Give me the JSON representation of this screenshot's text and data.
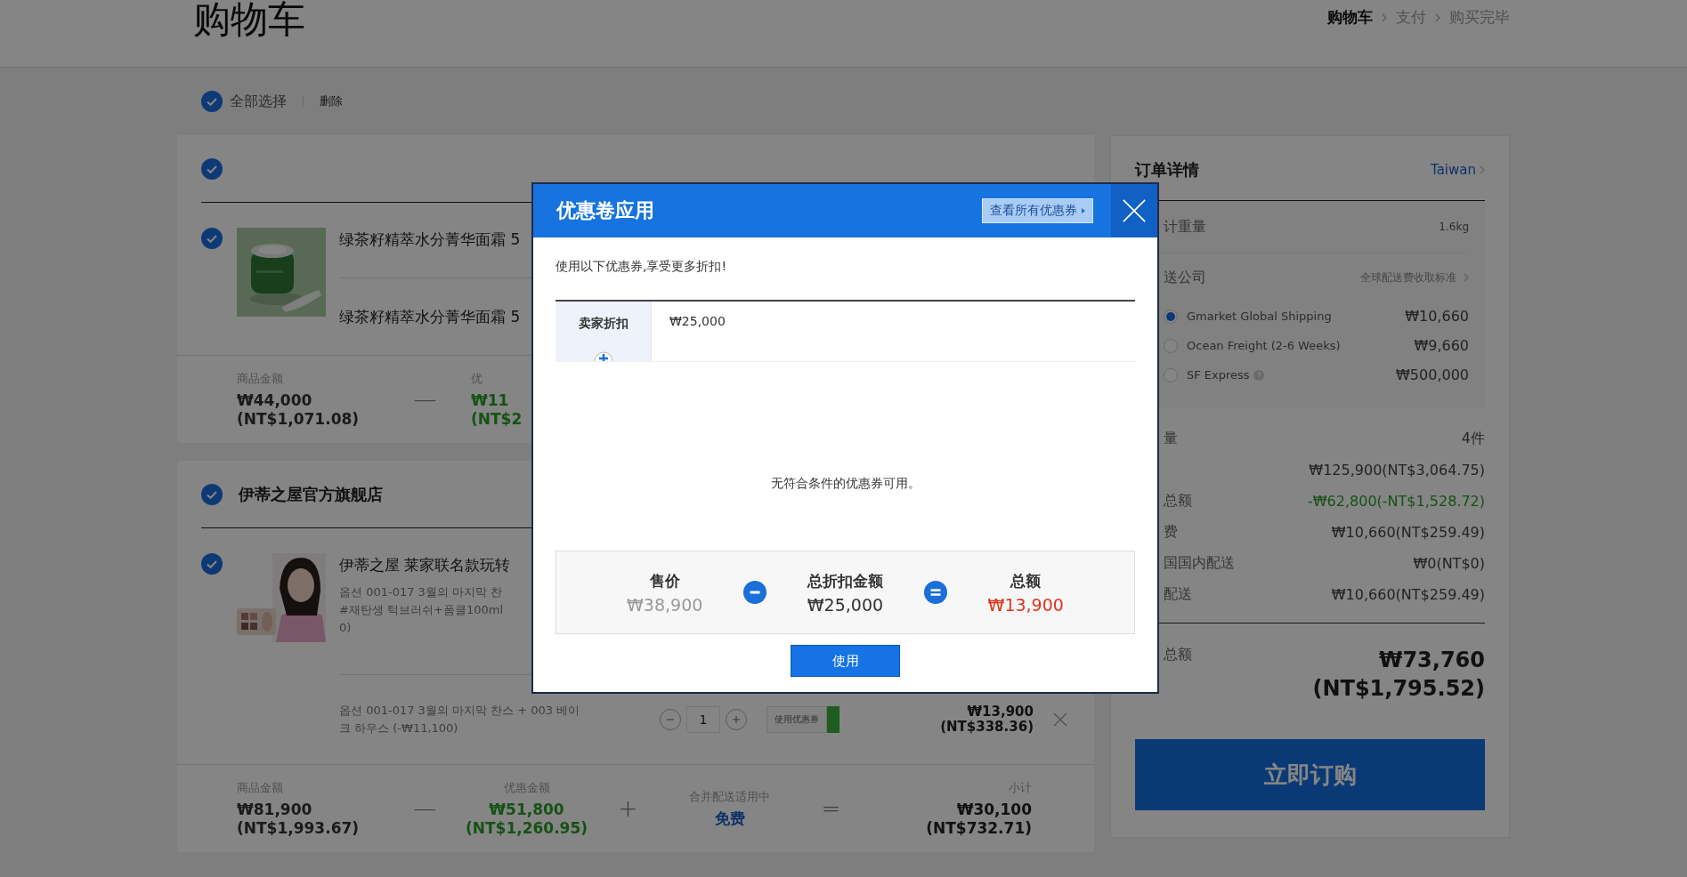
{
  "header": {
    "title": "购物车",
    "steps": [
      {
        "label": "购物车",
        "selected": true
      },
      {
        "label": "支付",
        "selected": false
      },
      {
        "label": "购买完毕",
        "selected": false
      }
    ]
  },
  "toolbar": {
    "select_all": {
      "label": "全部选择",
      "checked": true
    },
    "delete": "删除"
  },
  "sellers": [
    {
      "checked": true,
      "items": [
        {
          "checked": true,
          "title": "绿茶籽精萃水分菁华面霜 5",
          "option_rows": [
            {
              "lines": [
                "绿茶籽精萃水分菁华面霜 5"
              ]
            }
          ]
        }
      ],
      "summary": [
        {
          "kind": "amount",
          "label": "商品金额",
          "value": "₩44,000",
          "sub": "(NT$1,071.08)"
        },
        {
          "kind": "operator",
          "symbol": "—"
        },
        {
          "kind": "discount",
          "label": "优",
          "value": "₩11",
          "sub": "(NT$2"
        }
      ]
    },
    {
      "name": "伊蒂之屋官方旗舰店",
      "checked": true,
      "items": [
        {
          "checked": true,
          "title": "伊蒂之屋 莱家联名款玩转",
          "details": [
            "옵션 001-017 3월의 마지막 찬",
            "#재탄생 턱브러쉬+폼클100ml",
            "0)"
          ],
          "option_rows": [
            {
              "lines": [
                "옵션 001-017 3월의 마지막 찬스 + 003 베이",
                "크 하우스 (-₩11,100)"
              ],
              "quantity": "1",
              "coupon_button": "使用优惠券",
              "price": "₩13,900",
              "price_nt": "(NT$338.36)"
            }
          ]
        }
      ],
      "summary": [
        {
          "kind": "amount",
          "label": "商品金额",
          "value": "₩81,900",
          "sub": "(NT$1,993.67)"
        },
        {
          "kind": "operator",
          "symbol": "—"
        },
        {
          "kind": "discount",
          "label": "优惠金额",
          "value": "₩51,800",
          "sub": "(NT$1,260.95)"
        },
        {
          "kind": "operator",
          "symbol": "+"
        },
        {
          "kind": "shipping",
          "label": "合并配送适用中",
          "value": "免费"
        },
        {
          "kind": "operator",
          "symbol": "="
        },
        {
          "kind": "total",
          "label": "小计",
          "value": "₩30,100",
          "sub": "(NT$732.71)"
        }
      ]
    }
  ],
  "order": {
    "title": "订单详情",
    "country": "Taiwan",
    "weight_label": "计重量",
    "weight": "1.6kg",
    "carrier_label": "送公司",
    "carrier_link": "全球配送费收取标准",
    "carriers": [
      {
        "name": "Gmarket Global Shipping",
        "price": "₩10,660",
        "selected": true,
        "help": false
      },
      {
        "name": "Ocean Freight (2-6 Weeks)",
        "price": "₩9,660",
        "selected": false,
        "help": false
      },
      {
        "name": "SF Express",
        "price": "₩500,000",
        "selected": false,
        "help": true
      }
    ],
    "rows": [
      {
        "label": "量",
        "value": "4件",
        "kind": "plain"
      },
      {
        "value": "₩125,900(NT$3,064.75)",
        "kind": "plain"
      },
      {
        "label": "总额",
        "value": "-₩62,800(-NT$1,528.72)",
        "kind": "discount"
      },
      {
        "label": "费",
        "value": "₩10,660(NT$259.49)",
        "kind": "plain"
      },
      {
        "label": "国国内配送",
        "value": "₩0(NT$0)",
        "kind": "plain"
      },
      {
        "label": "配送",
        "value": "₩10,660(NT$259.49)",
        "kind": "plain"
      }
    ],
    "total_label": "总额",
    "total": "₩73,760",
    "total_nt": "(NT$1,795.52)",
    "order_button": "立即订购"
  },
  "modal": {
    "title": "优惠卷应用",
    "all_coupons_button": "查看所有优惠券",
    "intro": "使用以下优惠券,享受更多折扣!",
    "section_label": "卖家折扣",
    "section_value": "₩25,000",
    "empty": "无符合条件的优惠券可用。",
    "breakdown": [
      {
        "kind": "price",
        "label": "售价",
        "value": "₩38,900"
      },
      {
        "kind": "minus"
      },
      {
        "kind": "discount",
        "label": "总折扣金额",
        "value": "₩25,000"
      },
      {
        "kind": "equals"
      },
      {
        "kind": "total",
        "label": "总额",
        "value": "₩13,900"
      }
    ],
    "apply_button": "使用"
  }
}
